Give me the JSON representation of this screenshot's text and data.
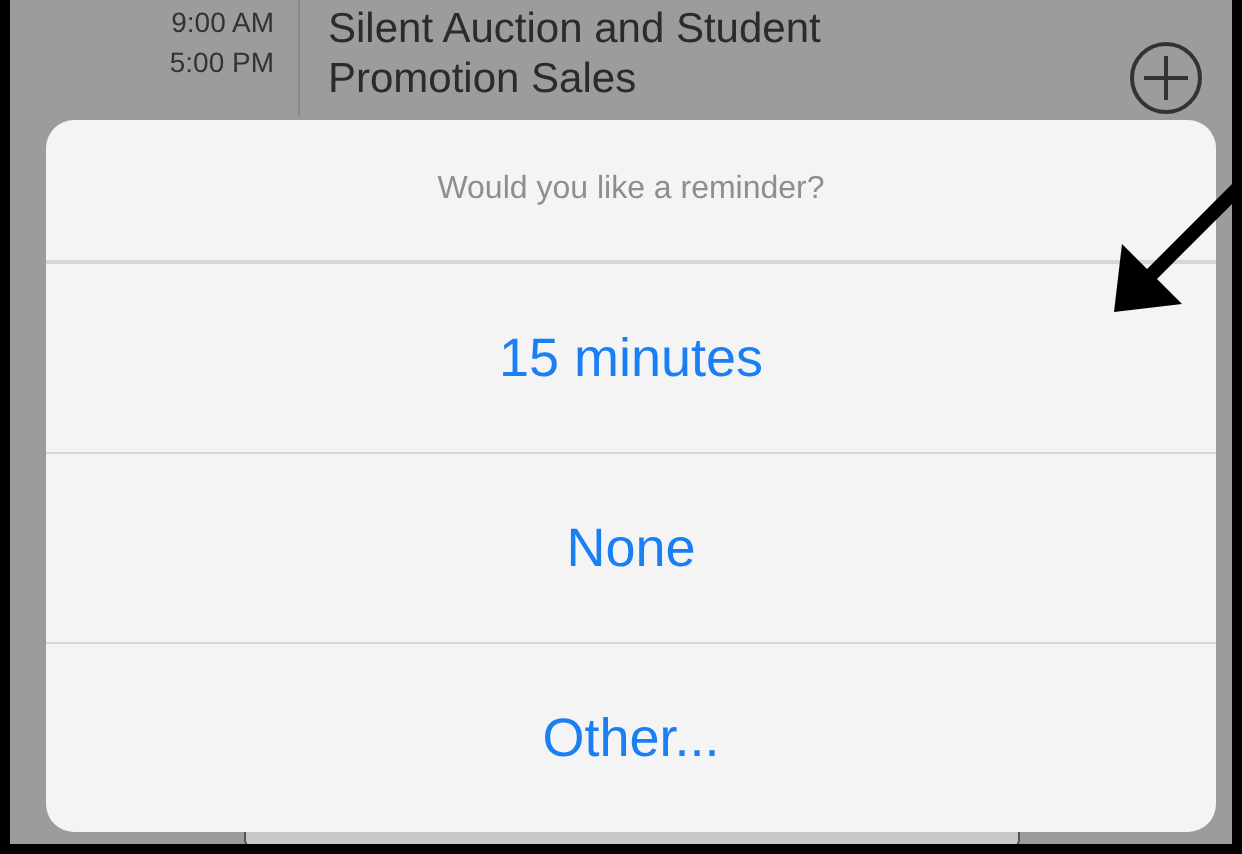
{
  "event": {
    "start_time": "9:00 AM",
    "end_time": "5:00 PM",
    "title": "Silent Auction and Student Promotion Sales"
  },
  "reminder_sheet": {
    "title": "Would you like a reminder?",
    "options": [
      "15 minutes",
      "None",
      "Other..."
    ]
  }
}
